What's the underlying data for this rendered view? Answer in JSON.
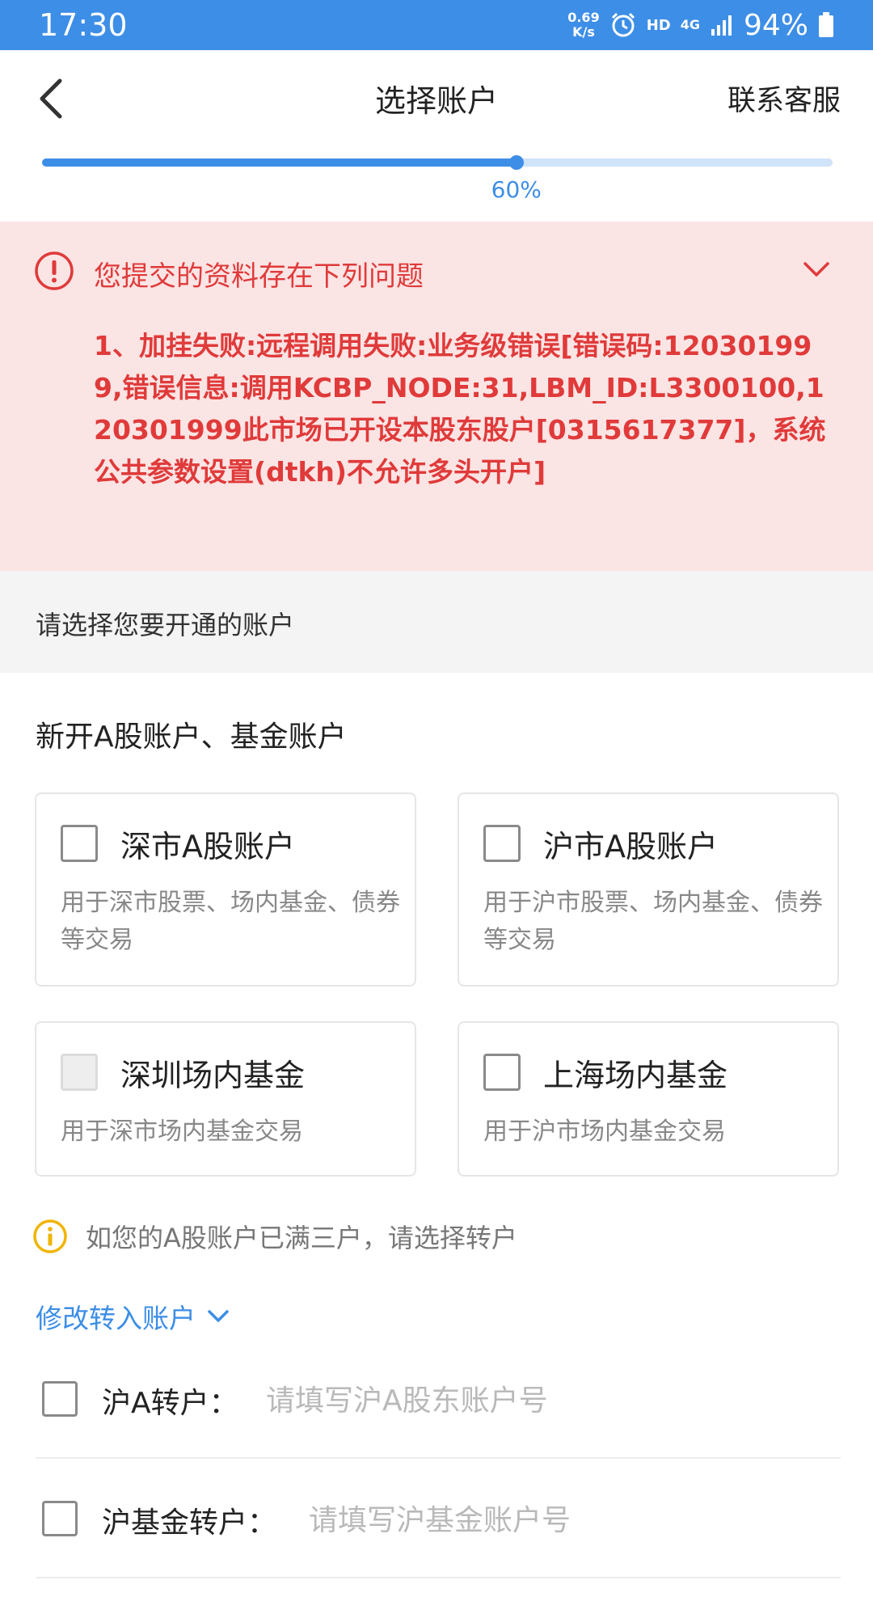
{
  "status_bar": {
    "time": "17:30",
    "net_speed_value": "0.69",
    "net_speed_unit": "K/s",
    "hd": "HD",
    "network": "4G",
    "battery": "94%"
  },
  "header": {
    "title": "选择账户",
    "support": "联系客服"
  },
  "progress": {
    "value": 0.6,
    "label": "60%"
  },
  "error": {
    "title": "您提交的资料存在下列问题",
    "message": "1、加挂失败:远程调用失败:业务级错误[错误码:120301999,错误信息:调用KCBP_NODE:31,LBM_ID:L3300100,120301999此市场已开设本股东股户[0315617377]，系统公共参数设置(dtkh)不允许多头开户]"
  },
  "section_hint": "请选择您要开通的账户",
  "group_title": "新开A股账户、基金账户",
  "cards": [
    {
      "title": "深市A股账户",
      "desc": "用于深市股票、场内基金、债券等交易"
    },
    {
      "title": "沪市A股账户",
      "desc": "用于沪市股票、场内基金、债券等交易"
    },
    {
      "title": "深圳场内基金",
      "desc": "用于深市场内基金交易"
    },
    {
      "title": "上海场内基金",
      "desc": "用于沪市场内基金交易"
    }
  ],
  "info_text": "如您的A股账户已满三户，请选择转户",
  "modify_link": "修改转入账户",
  "transfers": [
    {
      "label": "沪A转户：",
      "placeholder": "请填写沪A股东账户号",
      "value": ""
    },
    {
      "label": "沪基金转户：",
      "placeholder": "请填写沪基金账户号",
      "value": ""
    }
  ],
  "colors": {
    "primary": "#3d8ee6",
    "error": "#e03a3a",
    "error_bg": "#fbe4e4",
    "warning": "#f0b400"
  }
}
